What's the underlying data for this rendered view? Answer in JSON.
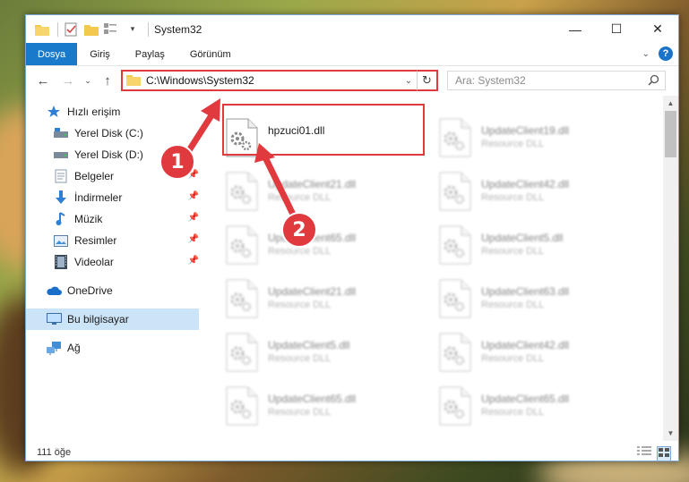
{
  "window": {
    "title": "System32",
    "controls": {
      "minimize": "—",
      "maximize": "☐",
      "close": "✕"
    }
  },
  "ribbon": {
    "tabs": [
      "Dosya",
      "Giriş",
      "Paylaş",
      "Görünüm"
    ],
    "help": "?"
  },
  "nav": {
    "address": "C:\\Windows\\System32",
    "search_placeholder": "Ara: System32"
  },
  "sidebar": {
    "quick_access": "Hızlı erişim",
    "items": [
      {
        "label": "Yerel Disk (C:)",
        "icon": "drive-c-icon",
        "pinned": false
      },
      {
        "label": "Yerel Disk (D:)",
        "icon": "drive-icon",
        "pinned": false
      },
      {
        "label": "Belgeler",
        "icon": "documents-icon",
        "pinned": true
      },
      {
        "label": "İndirmeler",
        "icon": "downloads-icon",
        "pinned": true
      },
      {
        "label": "Müzik",
        "icon": "music-icon",
        "pinned": true
      },
      {
        "label": "Resimler",
        "icon": "pictures-icon",
        "pinned": true
      },
      {
        "label": "Videolar",
        "icon": "videos-icon",
        "pinned": true
      }
    ],
    "onedrive": "OneDrive",
    "this_pc": "Bu bilgisayar",
    "network": "Ağ"
  },
  "files": [
    {
      "name": "hpzuci01.dll",
      "type": "",
      "highlighted": true
    },
    {
      "name": "UpdateClient19.dll",
      "type": "Resource DLL",
      "highlighted": false
    },
    {
      "name": "UpdateClient21.dll",
      "type": "Resource DLL",
      "highlighted": false
    },
    {
      "name": "UpdateClient42.dll",
      "type": "Resource DLL",
      "highlighted": false
    },
    {
      "name": "UpdateClient65.dll",
      "type": "Resource DLL",
      "highlighted": false
    },
    {
      "name": "UpdateClient5.dll",
      "type": "Resource DLL",
      "highlighted": false
    },
    {
      "name": "UpdateClient21.dll",
      "type": "Resource DLL",
      "highlighted": false
    },
    {
      "name": "UpdateClient63.dll",
      "type": "Resource DLL",
      "highlighted": false
    },
    {
      "name": "UpdateClient5.dll",
      "type": "Resource DLL",
      "highlighted": false
    },
    {
      "name": "UpdateClient42.dll",
      "type": "Resource DLL",
      "highlighted": false
    },
    {
      "name": "UpdateClient65.dll",
      "type": "Resource DLL",
      "highlighted": false
    },
    {
      "name": "UpdateClient65.dll",
      "type": "Resource DLL",
      "highlighted": false
    }
  ],
  "status": {
    "item_count": "111 öğe"
  },
  "callouts": [
    "1",
    "2"
  ],
  "colors": {
    "accent": "#1979ca",
    "highlight": "#e0393e",
    "selected_bg": "#cce4f7"
  }
}
